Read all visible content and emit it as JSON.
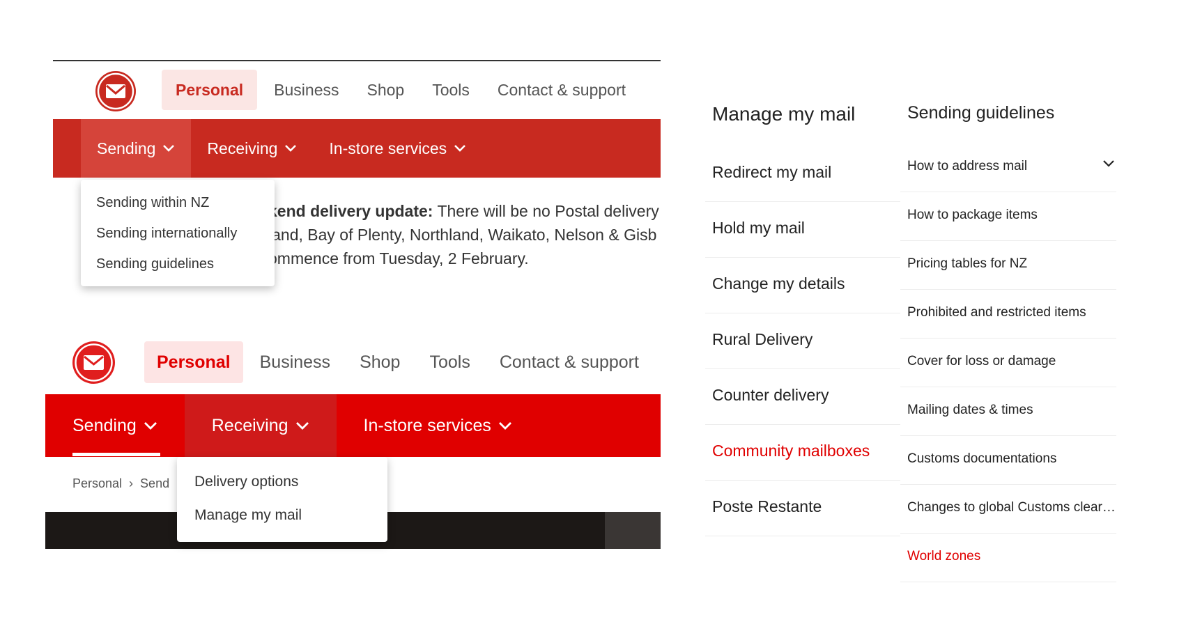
{
  "shot1": {
    "nav": [
      "Personal",
      "Business",
      "Shop",
      "Tools",
      "Contact & support"
    ],
    "tabs": [
      "Sending",
      "Receiving",
      "In-store services"
    ],
    "notice_lines": [
      {
        "bold": "kend delivery update:",
        "rest": " There will be no Postal delivery"
      },
      {
        "bold": "",
        "rest": "land, Bay of Plenty, Northland, Waikato, Nelson & Gisb"
      },
      {
        "bold": "",
        "rest": "ommence from Tuesday, 2 February."
      }
    ],
    "dropdown": [
      "Sending within NZ",
      "Sending internationally",
      "Sending guidelines"
    ]
  },
  "shot2": {
    "nav": [
      "Personal",
      "Business",
      "Shop",
      "Tools",
      "Contact & support"
    ],
    "tabs": [
      "Sending",
      "Receiving",
      "In-store services"
    ],
    "breadcrumb": [
      "Personal",
      "Send"
    ],
    "dropdown": [
      "Delivery options",
      "Manage my mail"
    ]
  },
  "manage_menu": {
    "title": "Manage my mail",
    "items": [
      {
        "label": "Redirect my mail",
        "active": false
      },
      {
        "label": "Hold my mail",
        "active": false
      },
      {
        "label": "Change my details",
        "active": false
      },
      {
        "label": "Rural Delivery",
        "active": false
      },
      {
        "label": "Counter delivery",
        "active": false
      },
      {
        "label": "Community mailboxes",
        "active": true
      },
      {
        "label": "Poste Restante",
        "active": false
      }
    ]
  },
  "guidelines_menu": {
    "title": "Sending guidelines",
    "items": [
      {
        "label": "How to address mail",
        "active": false,
        "expandable": true
      },
      {
        "label": "How to package items",
        "active": false
      },
      {
        "label": "Pricing tables for NZ",
        "active": false
      },
      {
        "label": "Prohibited and restricted items",
        "active": false
      },
      {
        "label": "Cover for loss or damage",
        "active": false
      },
      {
        "label": "Mailing dates & times",
        "active": false
      },
      {
        "label": "Customs documentations",
        "active": false
      },
      {
        "label": "Changes to global Customs clear…",
        "active": false
      },
      {
        "label": "World zones",
        "active": true
      }
    ]
  },
  "colors": {
    "old_red": "#c82a20",
    "new_red": "#e00000",
    "active_link": "#e00000"
  },
  "icons": {
    "logo": "mail-envelope-logo-icon",
    "chevron": "chevron-down-icon"
  }
}
